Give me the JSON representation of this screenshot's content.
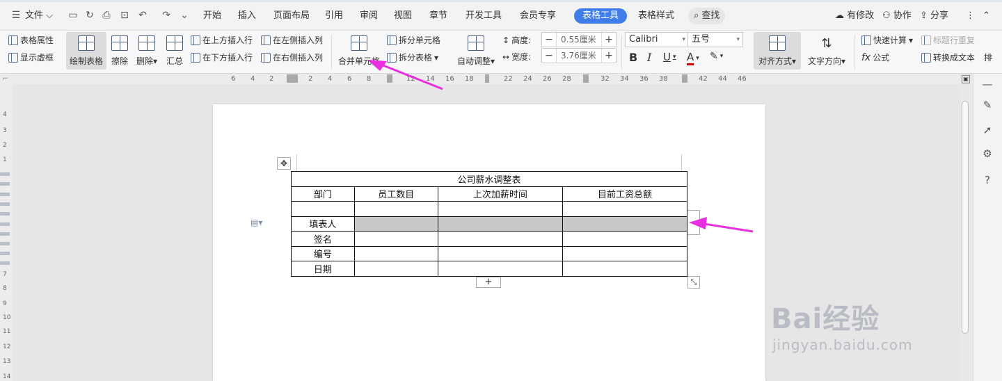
{
  "menu": {
    "file": "文件"
  },
  "tabs": [
    "开始",
    "插入",
    "页面布局",
    "引用",
    "审阅",
    "视图",
    "章节",
    "开发工具",
    "会员专享",
    "表格工具",
    "表格样式"
  ],
  "search_label": "查找",
  "right_actions": {
    "modified": "有修改",
    "collab": "协作",
    "share": "分享"
  },
  "ribbon": {
    "table_props": "表格属性",
    "show_gridlines": "显示虚框",
    "draw_table": "绘制表格",
    "erase": "擦除",
    "delete": "删除",
    "summary": "汇总",
    "insert_row_above": "在上方插入行",
    "insert_row_below": "在下方插入行",
    "insert_col_left": "在左侧插入列",
    "insert_col_right": "在右侧插入列",
    "merge_cells": "合并单元格",
    "split_cells": "拆分单元格",
    "split_table": "拆分表格",
    "auto_fit": "自动调整",
    "height_label": "高度:",
    "height_value": "0.55厘米",
    "width_label": "宽度:",
    "width_value": "3.76厘米",
    "font_name": "Calibri",
    "font_size": "五号",
    "align": "对齐方式",
    "text_direction": "文字方向",
    "quick_calc": "快速计算",
    "repeat_header": "标题行重复",
    "formula": "公式",
    "convert_text": "转换成文本",
    "more": "排"
  },
  "ruler_h": [
    "6",
    "4",
    "2",
    "2",
    "4",
    "6",
    "8",
    "12",
    "14",
    "16",
    "18",
    "22",
    "24",
    "26",
    "28",
    "32",
    "34",
    "36",
    "38",
    "42",
    "44",
    "46"
  ],
  "ruler_v": [
    "4",
    "3",
    "2",
    "1",
    "7",
    "8",
    "9",
    "10",
    "11",
    "12",
    "13",
    "14"
  ],
  "table": {
    "title": "公司薪水调整表",
    "headers": [
      "部门",
      "员工数目",
      "上次加薪时间",
      "目前工资总额"
    ],
    "rows": [
      [
        "",
        "",
        "",
        ""
      ],
      [
        "填表人",
        "",
        "",
        ""
      ],
      [
        "签名",
        "",
        "",
        ""
      ],
      [
        "编号",
        "",
        "",
        ""
      ],
      [
        "日期",
        "",
        "",
        ""
      ]
    ]
  },
  "watermark": {
    "brand": "Bai经验",
    "url": "jingyan.baidu.com"
  },
  "colors": {
    "accent": "#3f7ee8",
    "arrow": "#e930e0",
    "selected_cell": "#c8c8c8"
  }
}
